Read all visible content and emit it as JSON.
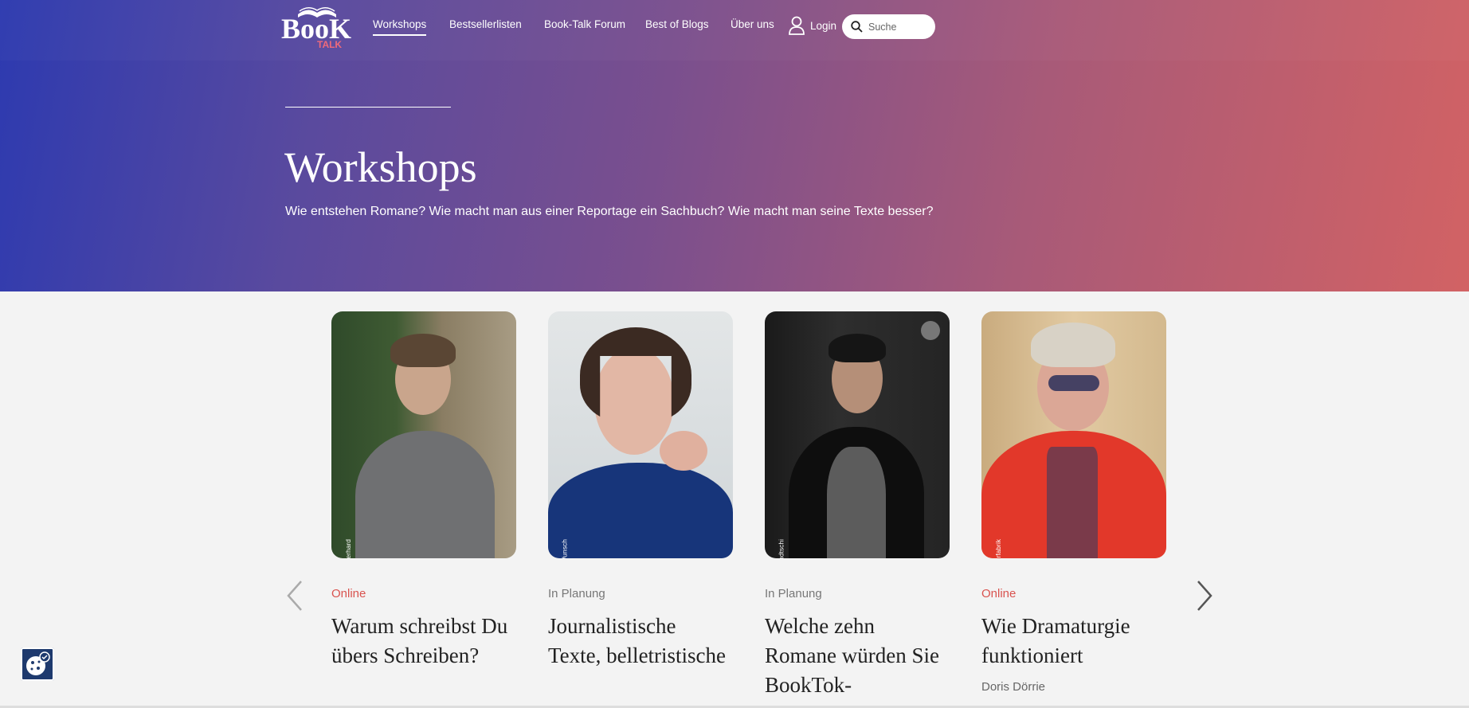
{
  "brand": {
    "logo_text": "BooK",
    "logo_sub": "TALK"
  },
  "nav": {
    "items": [
      {
        "label": "Workshops",
        "active": true
      },
      {
        "label": "Bestsellerlisten",
        "active": false
      },
      {
        "label": "Book-Talk Forum",
        "active": false
      },
      {
        "label": "Best of Blogs",
        "active": false
      },
      {
        "label": "Über uns",
        "active": false
      }
    ],
    "login_label": "Login",
    "search_placeholder": "Suche"
  },
  "hero": {
    "title": "Workshops",
    "subtitle": "Wie entstehen Romane? Wie macht man aus einer Reportage ein Sachbuch? Wie macht man seine Texte besser?"
  },
  "cards": [
    {
      "status": "Online",
      "status_type": "online",
      "title": "Warum schreibst Du übers Schreiben?",
      "author": "",
      "credit": "(c) Roger Eberhard"
    },
    {
      "status": "In Planung",
      "status_type": "plan",
      "title": "Journalistische Texte, belletristische",
      "author": "",
      "credit": "(c) Vanessa Wunsch"
    },
    {
      "status": "In Planung",
      "status_type": "plan",
      "title": "Welche zehn Romane würden Sie BookTok-",
      "author": "",
      "credit": "(c) Ali Ghandtschi"
    },
    {
      "status": "Online",
      "status_type": "online",
      "title": "Wie Dramaturgie funktioniert",
      "author": "Doris Dörrie",
      "credit": "(c) Reporterfabrik"
    }
  ],
  "colors": {
    "accent_online": "#d9534f",
    "gradient_start": "#2d3ab0",
    "gradient_end": "#d26264"
  }
}
